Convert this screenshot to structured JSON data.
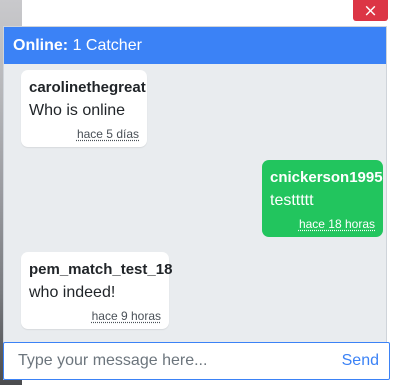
{
  "header": {
    "online_label": "Online:",
    "online_count": "1 Catcher"
  },
  "close_button": {
    "label": "×"
  },
  "messages": [
    {
      "sender": "carolinethegreat",
      "text": "Who is online",
      "time": "hace 5 días",
      "direction": "incoming"
    },
    {
      "sender": "cnickerson1995",
      "text": "testtttt",
      "time": "hace 18 horas",
      "direction": "outgoing"
    },
    {
      "sender": "pem_match_test_18",
      "text": "who indeed!",
      "time": "hace 9 horas",
      "direction": "incoming"
    }
  ],
  "composer": {
    "placeholder": "Type your message here...",
    "value": "",
    "send_label": "Send"
  },
  "colors": {
    "header": "#3b82f6",
    "outgoing_bubble": "#22c55e",
    "close": "#dc3545"
  }
}
